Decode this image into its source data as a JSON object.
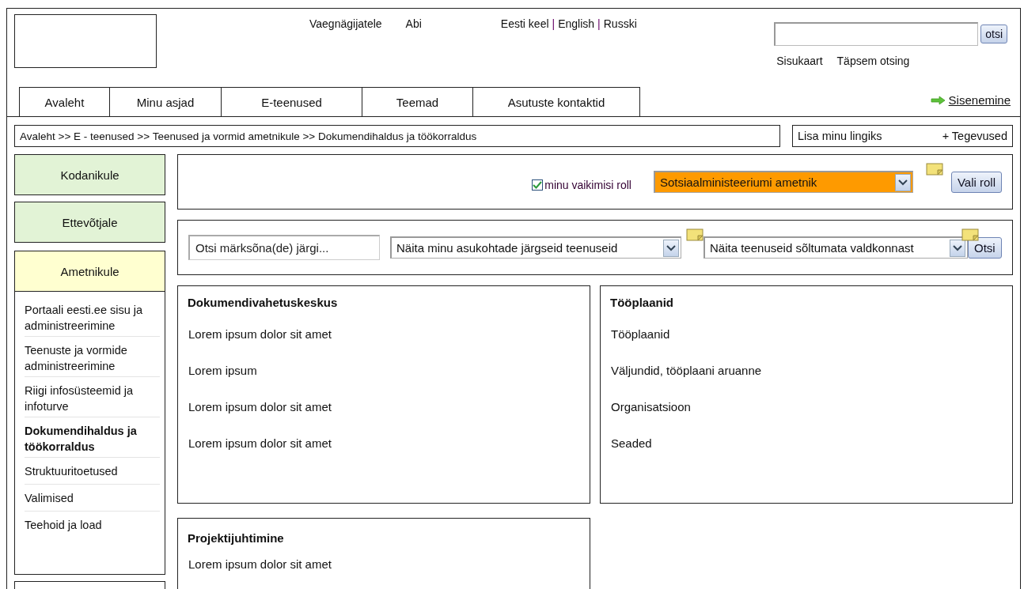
{
  "top_links": [
    "Vaegnägijatele",
    "Abi"
  ],
  "languages": [
    "Eesti keel",
    "English",
    "Russki"
  ],
  "language_separator": "|",
  "search": {
    "button": "otsi",
    "links": [
      "Sisukaart",
      "Täpsem otsing"
    ]
  },
  "nav_tabs": [
    "Avaleht",
    "Minu asjad",
    "E-teenused",
    "Teemad",
    "Asutuste kontaktid"
  ],
  "login": "Sisenemine",
  "breadcrumb": "Avaleht >> E - teenused >> Teenused ja vormid ametnikule >> Dokumendihaldus ja töökorraldus",
  "actions": [
    "Lisa minu lingiks",
    "+ Tegevused"
  ],
  "categories": [
    {
      "label": "Kodanikule",
      "selected": false
    },
    {
      "label": "Ettevõtjale",
      "selected": false
    },
    {
      "label": "Ametnikule",
      "selected": true
    }
  ],
  "sidebar_items": [
    {
      "label": "Portaali eesti.ee sisu ja administreerimine",
      "selected": false
    },
    {
      "label": "Teenuste ja vormide administreerimine",
      "selected": false
    },
    {
      "label": "Riigi infosüsteemid ja infoturve",
      "selected": false
    },
    {
      "label": "Dokumendihaldus ja töökorraldus",
      "selected": true
    },
    {
      "label": "Struktuuritoetused",
      "selected": false
    },
    {
      "label": "Valimised",
      "selected": false
    },
    {
      "label": "Teehoid ja load",
      "selected": false
    }
  ],
  "role": {
    "checkbox_label": "minu vaikimisi roll",
    "checked": true,
    "select_value": "Sotsiaalministeeriumi ametnik",
    "button": "Vali roll"
  },
  "filter": {
    "placeholder": "Otsi märksõna(de) järgi...",
    "select_1": "Näita minu asukohtade järgseid teenuseid",
    "select_2": "Näita teenuseid sõltumata valdkonnast",
    "button": "Otsi"
  },
  "cards": [
    {
      "title": "Dokumendivahetuskeskus",
      "links": [
        "Lorem ipsum dolor sit amet",
        "Lorem ipsum",
        "Lorem ipsum dolor sit amet",
        "Lorem ipsum dolor sit amet"
      ]
    },
    {
      "title": "Tööplaanid",
      "links": [
        "Tööplaanid",
        "Väljundid, tööplaani aruanne",
        "Organisatsioon",
        "Seaded"
      ]
    },
    {
      "title": "Projektijuhtimine",
      "links": [
        "Lorem ipsum dolor sit amet"
      ]
    }
  ]
}
